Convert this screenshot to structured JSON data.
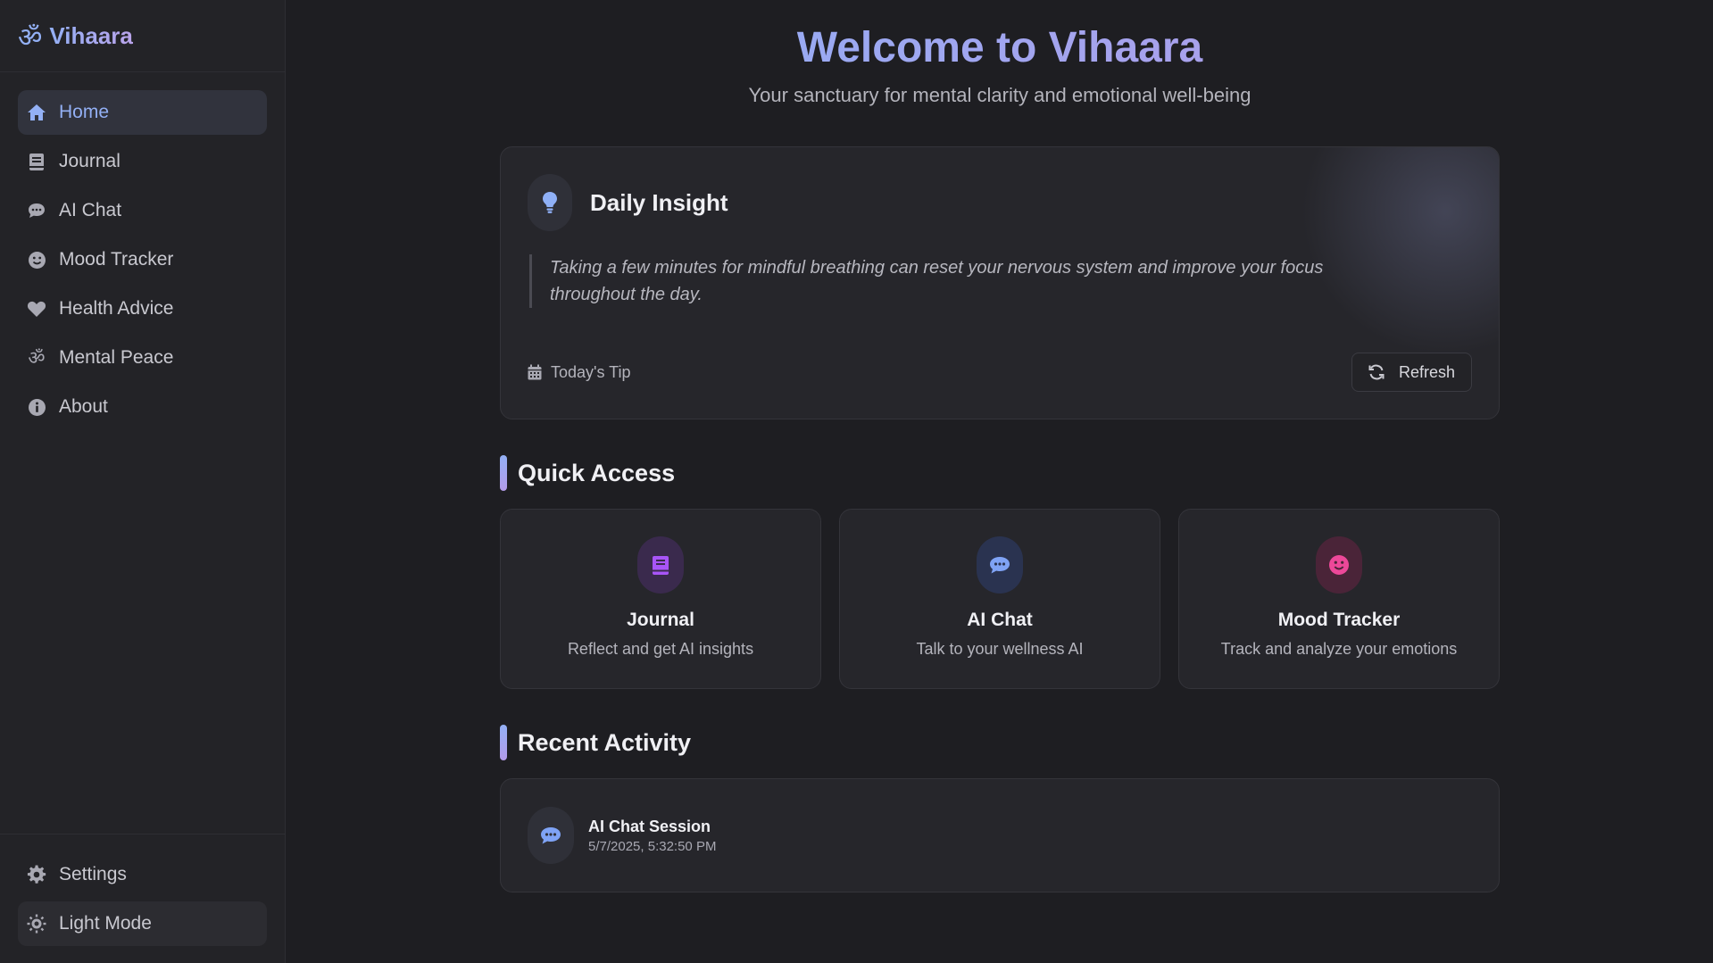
{
  "brand": {
    "icon": "om-icon",
    "glyph": "ॐ",
    "name": "Vihaara"
  },
  "sidebar": {
    "items": [
      {
        "label": "Home",
        "icon": "home-icon",
        "active": true
      },
      {
        "label": "Journal",
        "icon": "book-icon"
      },
      {
        "label": "AI Chat",
        "icon": "chat-icon"
      },
      {
        "label": "Mood Tracker",
        "icon": "smile-icon"
      },
      {
        "label": "Health Advice",
        "icon": "heart-icon"
      },
      {
        "label": "Mental Peace",
        "icon": "om-icon"
      },
      {
        "label": "About",
        "icon": "info-icon"
      }
    ],
    "settings_label": "Settings",
    "light_mode_label": "Light Mode"
  },
  "hero": {
    "title": "Welcome to Vihaara",
    "subtitle": "Your sanctuary for mental clarity and emotional well-being"
  },
  "insight": {
    "title": "Daily Insight",
    "quote": "Taking a few minutes for mindful breathing can reset your nervous system and improve your focus throughout the day.",
    "tip_label": "Today's Tip",
    "refresh_label": "Refresh"
  },
  "quick_access": {
    "title": "Quick Access",
    "cards": [
      {
        "title": "Journal",
        "desc": "Reflect and get AI insights",
        "icon": "book-icon",
        "color": "#a855f7",
        "bg": "#3a2a4d"
      },
      {
        "title": "AI Chat",
        "desc": "Talk to your wellness AI",
        "icon": "chat-icon",
        "color": "#7fa3f5",
        "bg": "#2a3350"
      },
      {
        "title": "Mood Tracker",
        "desc": "Track and analyze your emotions",
        "icon": "smile-icon",
        "color": "#ec4899",
        "bg": "#4a2438"
      }
    ]
  },
  "recent_activity": {
    "title": "Recent Activity",
    "items": [
      {
        "title": "AI Chat Session",
        "time": "5/7/2025, 5:32:50 PM",
        "icon": "chat-icon"
      }
    ]
  }
}
